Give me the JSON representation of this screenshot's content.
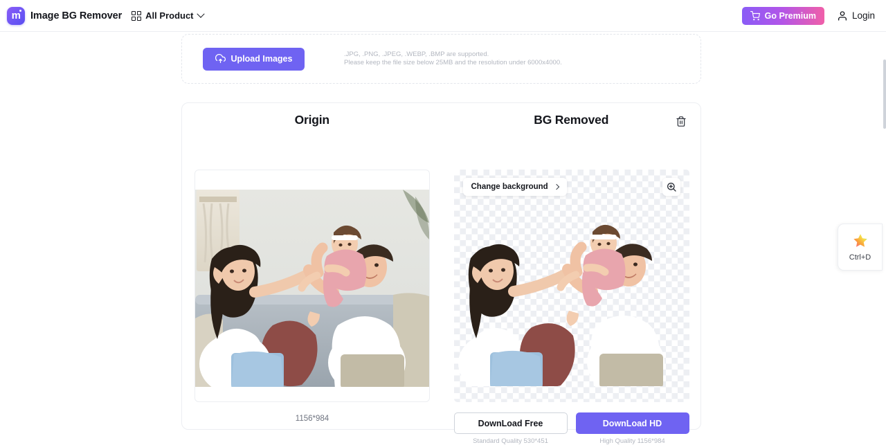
{
  "header": {
    "logo_letter": "m",
    "brand_title": "Image BG Remover",
    "all_product_label": "All Product",
    "premium_label": "Go Premium",
    "login_label": "Login"
  },
  "upload": {
    "button_label": "Upload Images",
    "note_line1": ".JPG, .PNG, .JPEG, .WEBP, .BMP are supported.",
    "note_line2": "Please keep the file size below 25MB and the resolution under 6000x4000."
  },
  "origin_pane": {
    "title": "Origin",
    "dimensions": "1156*984"
  },
  "result_pane": {
    "title": "BG Removed",
    "change_background_label": "Change background",
    "download_free_label": "DownLoad Free",
    "download_hd_label": "DownLoad HD",
    "download_free_sub": "Standard Quality 530*451",
    "download_hd_sub": "High Quality 1156*984"
  },
  "bookmark": {
    "shortcut_label": "Ctrl+D"
  },
  "colors": {
    "accent_purple": "#6f63f2",
    "premium_gradient_start": "#8a5cf6",
    "premium_gradient_end": "#f05fa8",
    "text_primary": "#14161c",
    "text_muted": "#b3b7c0",
    "border": "#eceef2",
    "checker": "#edeff3"
  }
}
